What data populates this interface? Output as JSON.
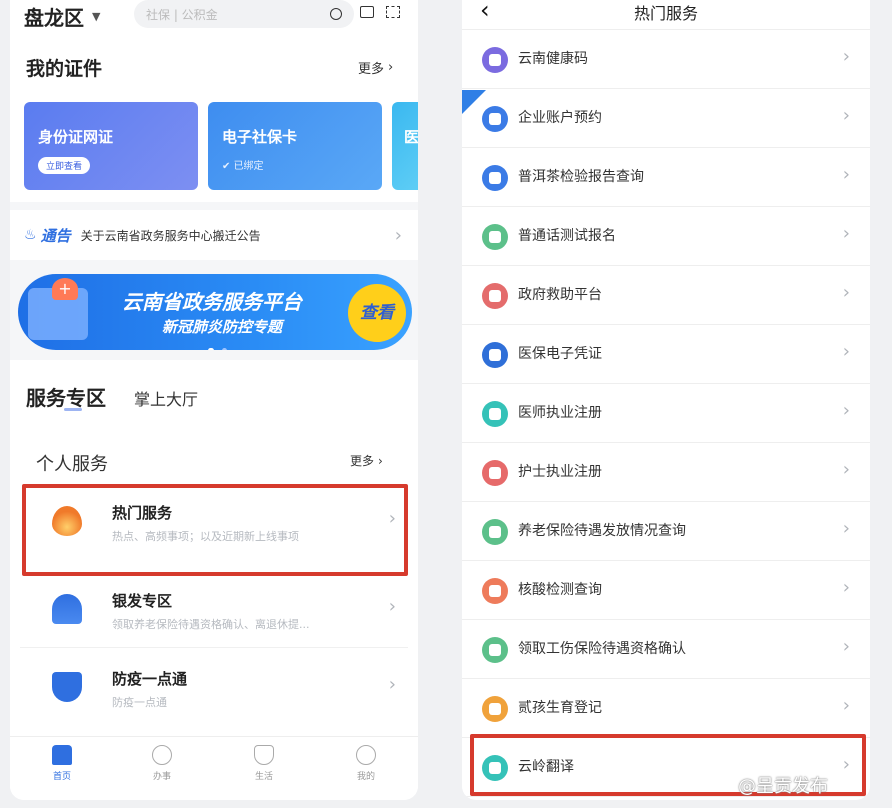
{
  "left": {
    "location": "盘龙区",
    "search_placeholder": "社保 | 公积金",
    "certs": {
      "title": "我的证件",
      "more": "更多",
      "cards": [
        {
          "title": "身份证网证",
          "badge": "立即查看"
        },
        {
          "title": "电子社保卡",
          "badge": "已绑定"
        },
        {
          "title": "医",
          "badge": ""
        }
      ]
    },
    "notice": {
      "tag": "通告",
      "text": "关于云南省政务服务中心搬迁公告"
    },
    "banner": {
      "title": "云南省政务服务平台",
      "subtitle": "新冠肺炎防控专题",
      "button": "查看"
    },
    "section_tabs": [
      "服务专区",
      "掌上大厅"
    ],
    "personal": {
      "title": "个人服务",
      "more": "更多"
    },
    "services": [
      {
        "title": "热门服务",
        "subtitle": "热点、高频事项；以及近期新上线事项"
      },
      {
        "title": "银发专区",
        "subtitle": "领取养老保险待遇资格确认、离退休提..."
      },
      {
        "title": "防疫一点通",
        "subtitle": "防疫一点通"
      }
    ],
    "tabbar": [
      "首页",
      "办事",
      "生活",
      "我的"
    ]
  },
  "right": {
    "title": "热门服务",
    "items": [
      {
        "label": "云南健康码",
        "color": "#7b6be0"
      },
      {
        "label": "企业账户预约",
        "color": "#3b7be6"
      },
      {
        "label": "普洱茶检验报告查询",
        "color": "#3b7be6"
      },
      {
        "label": "普通话测试报名",
        "color": "#5cc08a"
      },
      {
        "label": "政府救助平台",
        "color": "#e46c6c"
      },
      {
        "label": "医保电子凭证",
        "color": "#2f6fd8"
      },
      {
        "label": "医师执业注册",
        "color": "#35c2b8"
      },
      {
        "label": "护士执业注册",
        "color": "#e66a6a"
      },
      {
        "label": "养老保险待遇发放情况查询",
        "color": "#5cc08a"
      },
      {
        "label": "核酸检测查询",
        "color": "#ee7b5b"
      },
      {
        "label": "领取工伤保险待遇资格确认",
        "color": "#5cc08a"
      },
      {
        "label": "贰孩生育登记",
        "color": "#f0a23b"
      },
      {
        "label": "云岭翻译",
        "color": "#35c2b8"
      }
    ]
  },
  "watermark": "@呈贡发布"
}
